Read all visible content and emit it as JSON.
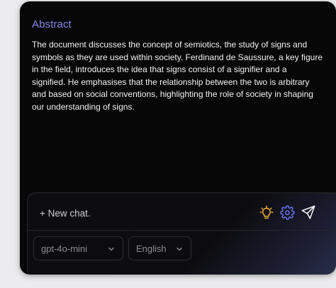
{
  "abstract": {
    "title": "Abstract",
    "body": "The document discusses the concept of semiotics, the study of signs and symbols as they are used within society. Ferdinand de Saussure, a key figure in the field, introduces the idea that signs consist of a signifier and a signified. He emphasises that the relationship between the two is arbitrary and based on social conventions, highlighting the role of society in shaping our understanding of signs."
  },
  "composer": {
    "placeholder": "+ New chat.",
    "icons": {
      "idea": "lightbulb-icon",
      "settings": "gear-icon",
      "send": "send-icon"
    },
    "model_select": {
      "value": "gpt-4o-mini"
    },
    "language_select": {
      "value": "English"
    }
  },
  "colors": {
    "accent": "#8487ea",
    "bulb": "#f2b233",
    "gear": "#6e74f0",
    "background": "#070708"
  }
}
